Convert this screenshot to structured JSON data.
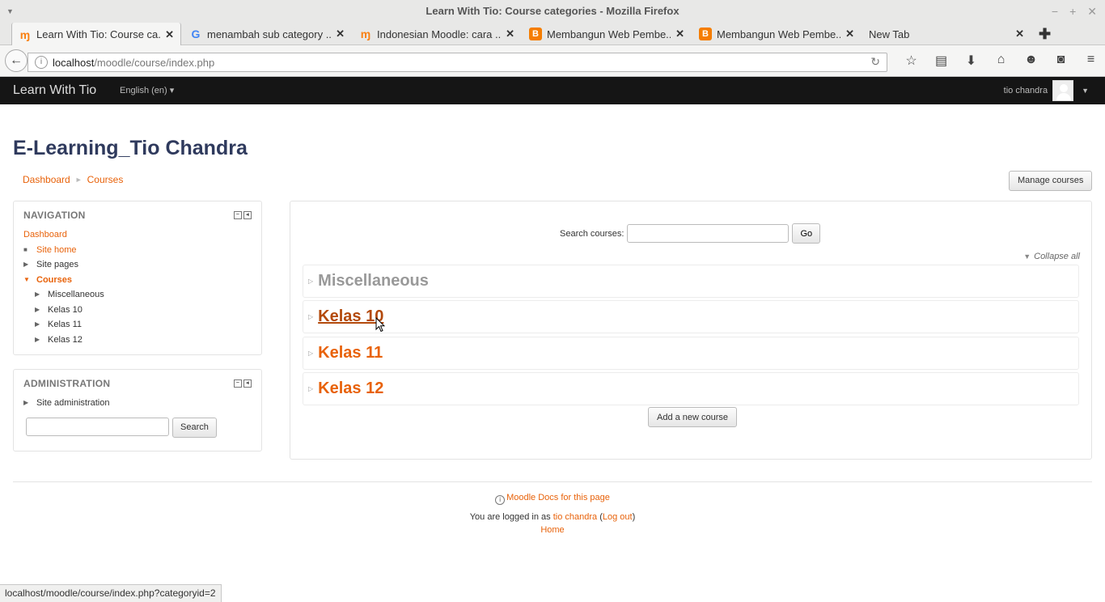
{
  "window": {
    "title": "Learn With Tio: Course categories - Mozilla Firefox"
  },
  "tabs": [
    {
      "label": "Learn With Tio: Course ca...",
      "favicon": "moodle-icon"
    },
    {
      "label": "menambah sub category ...",
      "favicon": "google-icon"
    },
    {
      "label": "Indonesian Moodle: cara ...",
      "favicon": "moodle-icon"
    },
    {
      "label": "Membangun Web Pembe...",
      "favicon": "blogger-icon"
    },
    {
      "label": "Membangun Web Pembe...",
      "favicon": "blogger-icon"
    },
    {
      "label": "New Tab",
      "favicon": ""
    }
  ],
  "url": {
    "host": "localhost",
    "path": "/moodle/course/index.php"
  },
  "moodle_nav": {
    "brand": "Learn With Tio",
    "language": "English (en) ▾",
    "user": "tio chandra"
  },
  "page": {
    "heading": "E-Learning_Tio Chandra",
    "breadcrumb": [
      "Dashboard",
      "Courses"
    ],
    "manage_courses": "Manage courses"
  },
  "navigation_block": {
    "title": "NAVIGATION",
    "items": [
      {
        "label": "Dashboard"
      },
      {
        "label": "Site home"
      },
      {
        "label": "Site pages"
      },
      {
        "label": "Courses"
      },
      {
        "label": "Miscellaneous"
      },
      {
        "label": "Kelas 10"
      },
      {
        "label": "Kelas 11"
      },
      {
        "label": "Kelas 12"
      }
    ]
  },
  "admin_block": {
    "title": "ADMINISTRATION",
    "site_admin": "Site administration",
    "search_button": "Search"
  },
  "course_search": {
    "label": "Search courses:",
    "button": "Go"
  },
  "collapse_all": "Collapse all",
  "categories": [
    "Miscellaneous",
    "Kelas 10",
    "Kelas 11",
    "Kelas 12"
  ],
  "add_course": "Add a new course",
  "footer": {
    "docs": "Moodle Docs for this page",
    "logged_in_prefix": "You are logged in as",
    "user": "tio chandra",
    "logout": "Log out",
    "home": "Home"
  },
  "statusbar": "localhost/moodle/course/index.php?categoryid=2"
}
